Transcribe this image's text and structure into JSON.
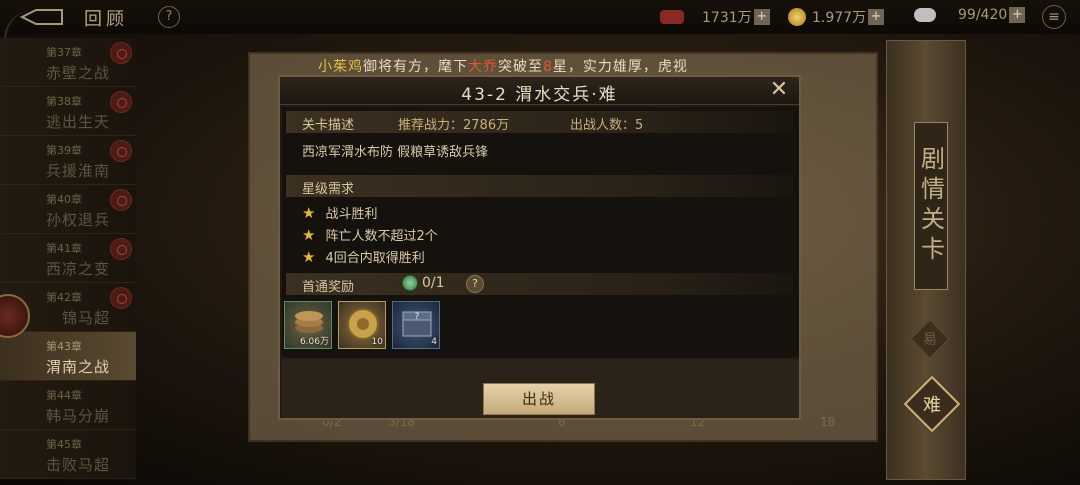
{
  "topbar": {
    "title": "回顾",
    "help": "?",
    "resources": [
      {
        "icon": "ticket-icon",
        "value": "1731万"
      },
      {
        "icon": "copper-coin-icon",
        "value": "1.977万"
      },
      {
        "icon": "stamina-cloud-icon",
        "value": "99/420"
      }
    ],
    "plus": "+",
    "menu": "≡"
  },
  "chapters": [
    {
      "num": "第37章",
      "name": "赤壁之战"
    },
    {
      "num": "第38章",
      "name": "逃出生天"
    },
    {
      "num": "第39章",
      "name": "兵援淮南"
    },
    {
      "num": "第40章",
      "name": "孙权退兵"
    },
    {
      "num": "第41章",
      "name": "西凉之变"
    },
    {
      "num": "第42章",
      "name": "锦马超"
    },
    {
      "num": "第43章",
      "name": "渭南之战"
    },
    {
      "num": "第44章",
      "name": "韩马分崩"
    },
    {
      "num": "第45章",
      "name": "击败马超"
    }
  ],
  "banner": {
    "player": "小茱鸡",
    "text1": "御将有方，麾下",
    "hero": "大乔",
    "text2": "突破至",
    "stars": "8",
    "text3": "星，实力雄厚，虎视"
  },
  "modal": {
    "title": "43-2 渭水交兵·难",
    "close": "✕",
    "stage_desc_label": "关卡描述",
    "recommended_power": "推荐战力：2786万",
    "deploy_count": "出战人数：5",
    "description": "西凉军渭水布防 假粮草诱敌兵锋",
    "star_req_label": "星级需求",
    "requirements": [
      "战斗胜利",
      "阵亡人数不超过2个",
      "4回合内取得胜利"
    ],
    "first_clear_label": "首通奖励",
    "first_clear_progress": "0/1",
    "help": "?",
    "rewards": [
      {
        "icon": "coin-stack-icon",
        "qty": "6.06万"
      },
      {
        "icon": "gold-medal-icon",
        "qty": "10"
      },
      {
        "icon": "mystery-box-icon",
        "qty": "4"
      }
    ],
    "fight_button": "出战"
  },
  "under_panel": {
    "progress_a": "0/2",
    "progress_b": "3/18",
    "milestones": [
      "6",
      "12",
      "18"
    ]
  },
  "side_scroll": {
    "title": "剧情关卡",
    "easy": "易",
    "hard": "难"
  },
  "colors": {
    "accent_gold": "#e3b53c",
    "banner_red": "#e05a30",
    "banner_yellow": "#e6c140"
  }
}
